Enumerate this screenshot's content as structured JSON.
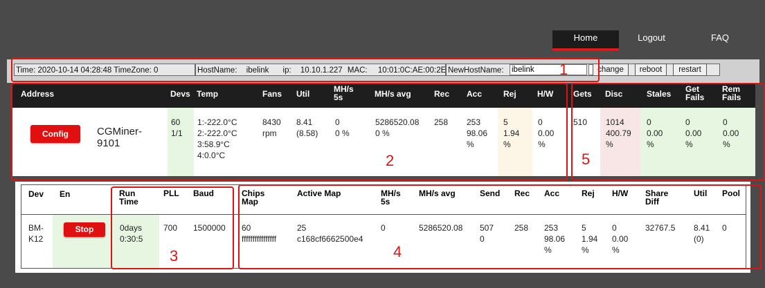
{
  "nav": {
    "home": "Home",
    "logout": "Logout",
    "faq": "FAQ"
  },
  "info": {
    "time_label": "Time: 2020-10-14 04:28:48 TimeZone: 0",
    "hostname_label": "HostName:",
    "hostname": "ibelink",
    "ip_label": "ip:",
    "ip": "10.10.1.227",
    "mac_label": "MAC:",
    "mac": "10:01:0C:AE:00:2E",
    "newhost_label": "NewHostName:",
    "newhost_value": "ibelink",
    "extra_value": "",
    "change_label": "change",
    "reboot_label": "reboot",
    "restart_label": "restart"
  },
  "summary": {
    "headers": {
      "address": "Address",
      "devs": "Devs",
      "temp": "Temp",
      "fans": "Fans",
      "util": "Util",
      "mhs5s": "MH/s\n5s",
      "mhsavg": "MH/s avg",
      "rec": "Rec",
      "acc": "Acc",
      "rej": "Rej",
      "hw": "H/W",
      "gets": "Gets",
      "disc": "Disc",
      "stales": "Stales",
      "getfails": "Get\nFails",
      "remfails": "Rem\nFails"
    },
    "row": {
      "config_label": "Config",
      "miner": "CGMiner-\n9101",
      "devs": "60\n1/1",
      "temp": "1:-222.0°C\n2:-222.0°C\n3:58.9°C\n4:0.0°C",
      "fans": "8430\nrpm",
      "util": "8.41\n(8.58)",
      "mhs5s": "0\n0 %",
      "mhsavg": "5286520.08\n0 %",
      "rec": "258",
      "acc": "253\n98.06\n%",
      "rej": "5\n1.94\n%",
      "hw": "0\n0.00\n%",
      "gets": "510",
      "disc": "1014\n400.79\n%",
      "stales": "0\n0.00\n%",
      "getfails": "0\n0.00\n%",
      "remfails": "0\n0.00\n%"
    }
  },
  "devices": {
    "headers": {
      "dev": "Dev",
      "en": "En",
      "runtime": "Run\nTime",
      "pll": "PLL",
      "baud": "Baud",
      "chipsmap": "Chips\nMap",
      "activemap": "Active Map",
      "mhs5s": "MH/s\n5s",
      "mhsavg": "MH/s avg",
      "send": "Send",
      "rec": "Rec",
      "acc": "Acc",
      "rej": "Rej",
      "hw": "H/W",
      "sharediff": "Share\nDiff",
      "util": "Util",
      "pool": "Pool"
    },
    "row": {
      "dev": "BM-\nK12",
      "stop_label": "Stop",
      "runtime": "0days\n0:30:5",
      "pll": "700",
      "baud": "1500000",
      "chipsmap": "60\nffffffffffffffff",
      "activemap": "25\nc168cf6662500e4",
      "mhs5s": "0",
      "mhsavg": "5286520.08",
      "send": "507\n0",
      "rec": "258",
      "acc": "253\n98.06\n%",
      "rej": "5\n1.94\n%",
      "hw": "0\n0.00\n%",
      "sharediff": "32767.5",
      "util": "8.41\n(0)",
      "pool": "0"
    }
  },
  "annotations": {
    "n1": "1",
    "n2": "2",
    "n3": "3",
    "n4": "4",
    "n5": "5"
  },
  "colors": {
    "accent": "#e01010",
    "annotation": "#e01313",
    "header_bg": "#1e1e1e",
    "green_cell": "#e6f6e1",
    "pink_cell": "#f8e5e5",
    "cream_cell": "#fdf6e6"
  }
}
